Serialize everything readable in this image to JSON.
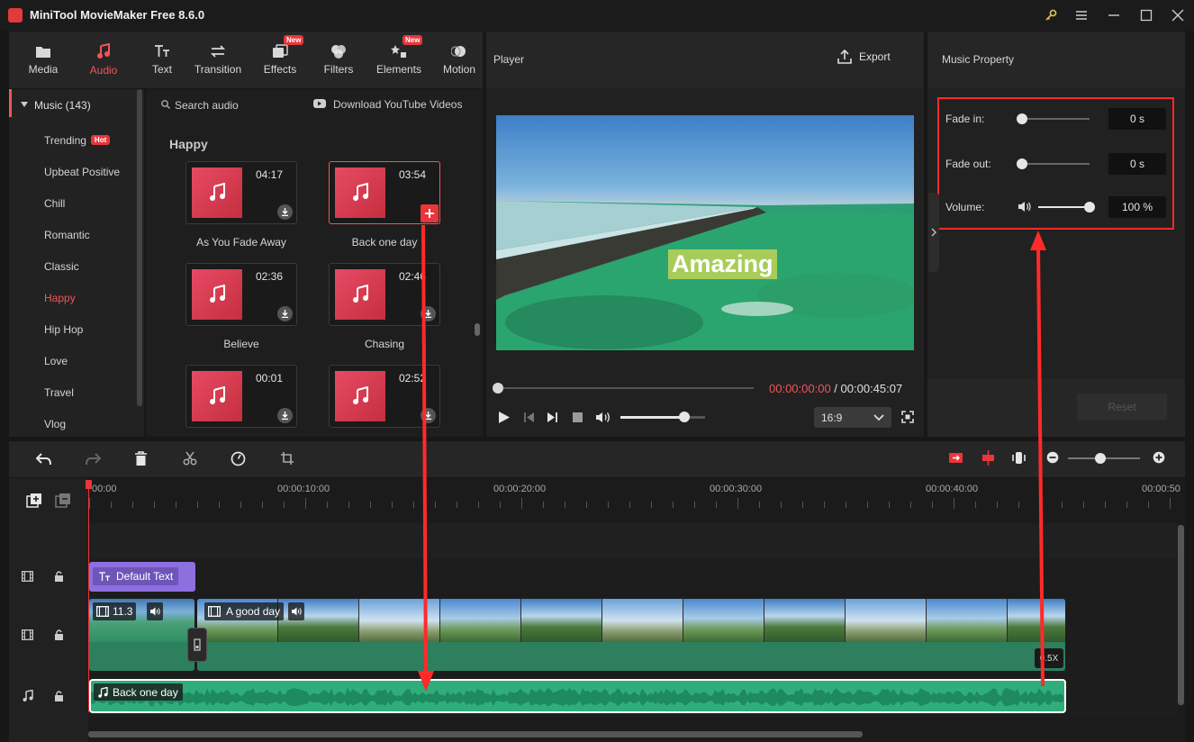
{
  "window": {
    "title": "MiniTool MovieMaker Free 8.6.0"
  },
  "toolbar": {
    "tools": [
      {
        "label": "Media"
      },
      {
        "label": "Audio"
      },
      {
        "label": "Text"
      },
      {
        "label": "Transition"
      },
      {
        "label": "Effects",
        "badge": "New"
      },
      {
        "label": "Filters"
      },
      {
        "label": "Elements",
        "badge": "New"
      },
      {
        "label": "Motion"
      }
    ]
  },
  "library": {
    "header": "Music (143)",
    "categories": [
      "Trending",
      "Upbeat Positive",
      "Chill",
      "Romantic",
      "Classic",
      "Happy",
      "Hip Hop",
      "Love",
      "Travel",
      "Vlog"
    ],
    "hot_badge": "Hot",
    "search_label": "Search audio",
    "download_label": "Download YouTube Videos",
    "section_title": "Happy",
    "items": [
      {
        "name": "As You Fade Away",
        "duration": "04:17"
      },
      {
        "name": "Back one day",
        "duration": "03:54"
      },
      {
        "name": "Believe",
        "duration": "02:36"
      },
      {
        "name": "Chasing",
        "duration": "02:46"
      },
      {
        "name": "",
        "duration": "00:01"
      },
      {
        "name": "",
        "duration": "02:52"
      }
    ]
  },
  "player": {
    "title": "Player",
    "export_label": "Export",
    "overlay_text": "Amazing",
    "current_time": "00:00:00:00",
    "separator": " / ",
    "total_time": "00:00:45:07",
    "aspect": "16:9",
    "volume_level": 0.76
  },
  "property": {
    "title": "Music Property",
    "fade_in_label": "Fade in:",
    "fade_in_value": "0 s",
    "fade_out_label": "Fade out:",
    "fade_out_value": "0 s",
    "volume_label": "Volume:",
    "volume_value": "100 %",
    "reset_label": "Reset"
  },
  "timeline": {
    "ruler": [
      "00:00",
      "00:00:10:00",
      "00:00:20:00",
      "00:00:30:00",
      "00:00:40:00",
      "00:00:50"
    ],
    "text_clip": "Default Text",
    "video_clip1": "11.3",
    "video_clip2": "A good day",
    "speed_badge": "0.5X",
    "audio_clip": "Back one day",
    "zoom_level": 0.45
  },
  "colors": {
    "accent": "#f2555a",
    "audio_track": "#2fae7c",
    "text_clip": "#8e6fe0",
    "highlight": "#ff2a2a"
  }
}
